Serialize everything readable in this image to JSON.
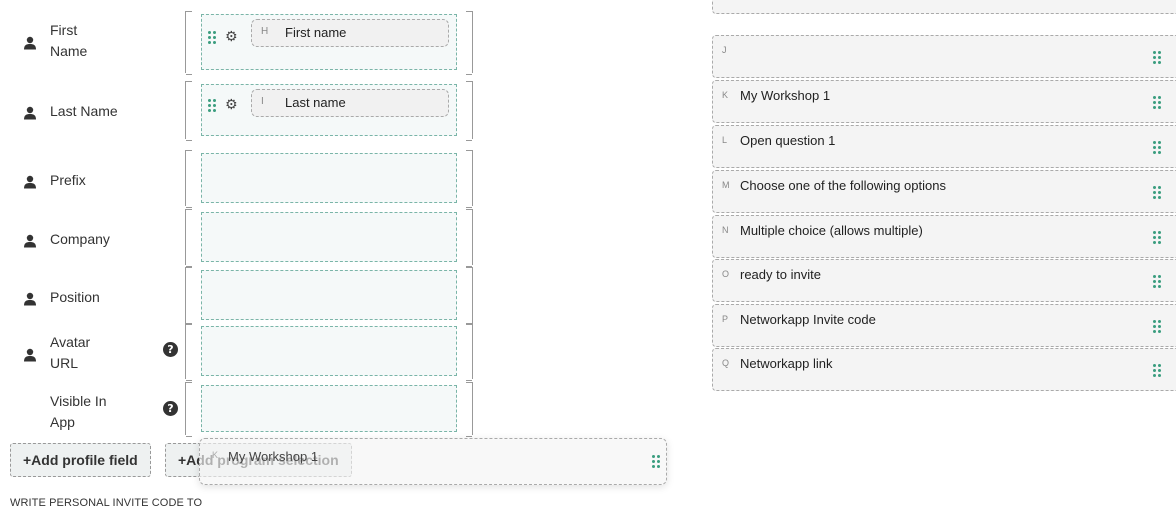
{
  "profile_fields": [
    {
      "label_lines": [
        "First",
        "Name"
      ],
      "has_person_icon": true,
      "has_help": false,
      "mapped": {
        "letter": "H",
        "text": "First name"
      }
    },
    {
      "label_lines": [
        "Last Name"
      ],
      "has_person_icon": true,
      "has_help": false,
      "mapped": {
        "letter": "I",
        "text": "Last name"
      }
    },
    {
      "label_lines": [
        "Prefix"
      ],
      "has_person_icon": true,
      "has_help": false,
      "mapped": null
    },
    {
      "label_lines": [
        "Company"
      ],
      "has_person_icon": true,
      "has_help": false,
      "mapped": null
    },
    {
      "label_lines": [
        "Position"
      ],
      "has_person_icon": true,
      "has_help": false,
      "mapped": null
    },
    {
      "label_lines": [
        "Avatar",
        "URL"
      ],
      "has_person_icon": true,
      "has_help": true,
      "mapped": null
    },
    {
      "label_lines": [
        "Visible In",
        "App"
      ],
      "has_person_icon": false,
      "has_help": true,
      "mapped": null
    }
  ],
  "buttons": {
    "add_profile_field": "+Add profile field",
    "add_program_selection": "+Add program selection"
  },
  "dragging": {
    "letter": "K",
    "text": "My Workshop 1"
  },
  "section_title": "WRITE PERSONAL INVITE CODE TO",
  "help_glyph": "?",
  "gear_glyph": "⚙",
  "questions": [
    {
      "letter": "",
      "text": ""
    },
    {
      "letter": "J",
      "text": ""
    },
    {
      "letter": "K",
      "text": "My Workshop 1"
    },
    {
      "letter": "L",
      "text": "Open question 1"
    },
    {
      "letter": "M",
      "text": "Choose one of the following options"
    },
    {
      "letter": "N",
      "text": "Multiple choice (allows multiple)"
    },
    {
      "letter": "O",
      "text": "ready to invite"
    },
    {
      "letter": "P",
      "text": "Networkapp Invite code"
    },
    {
      "letter": "Q",
      "text": "Networkapp link"
    }
  ],
  "colors": {
    "accent": "#3a9d7f",
    "dropzone_border": "#7ab5a8"
  }
}
